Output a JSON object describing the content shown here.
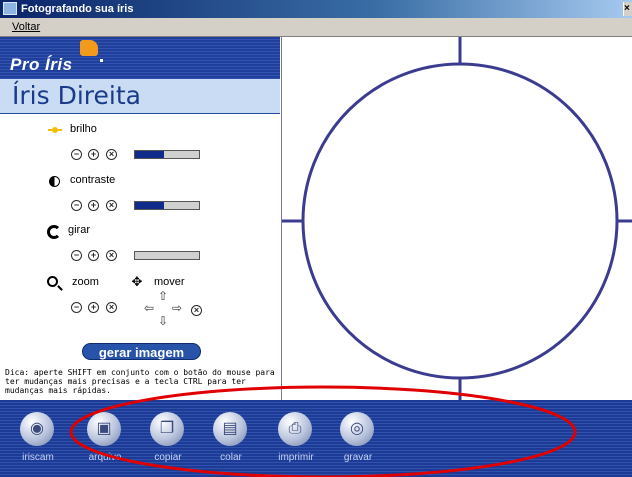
{
  "window": {
    "title": "Fotografando sua íris",
    "close_glyph": "×"
  },
  "menu": {
    "items": [
      {
        "label": "Voltar"
      }
    ]
  },
  "brand": {
    "logo_text": "Pro Íris"
  },
  "panel": {
    "heading": "Íris Direita",
    "controls": {
      "brilho": {
        "label": "brilho",
        "level": 0.45,
        "icon": "sun-icon"
      },
      "contraste": {
        "label": "contraste",
        "level": 0.45,
        "icon": "contrast-icon"
      },
      "girar": {
        "label": "girar",
        "level": 0.0,
        "icon": "rotate-icon"
      },
      "zoom": {
        "label": "zoom",
        "icon": "magnifier-icon"
      },
      "mover": {
        "label": "mover",
        "icon": "move-icon"
      }
    },
    "button_symbols": {
      "minus": "−",
      "plus": "+",
      "reset": "×"
    },
    "generate_button": "gerar imagem",
    "tip": "Dica: aperte SHIFT em conjunto com o botão do mouse para ter mudanças mais precisas e a tecla CTRL para ter mudanças mais rápidas."
  },
  "toolbar": {
    "items": [
      {
        "label": "iriscam",
        "icon": "camera-icon",
        "glyph": "◉"
      },
      {
        "label": "arquivo",
        "icon": "floppy-icon",
        "glyph": "▣"
      },
      {
        "label": "copiar",
        "icon": "copy-icon",
        "glyph": "❐"
      },
      {
        "label": "colar",
        "icon": "paste-icon",
        "glyph": "▤"
      },
      {
        "label": "imprimir",
        "icon": "printer-icon",
        "glyph": "⎙"
      },
      {
        "label": "gravar",
        "icon": "disc-icon",
        "glyph": "◎"
      }
    ]
  },
  "colors": {
    "accent": "#2754a8",
    "circle": "#3b3c8f",
    "annotation": "#e00000"
  }
}
